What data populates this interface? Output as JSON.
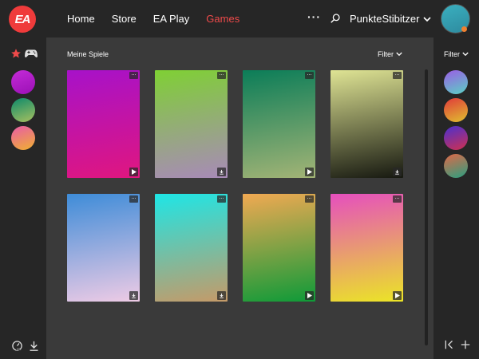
{
  "brand": {
    "logo_text": "EA",
    "accent": "#ef3b3b"
  },
  "nav": {
    "items": [
      {
        "label": "Home",
        "active": false
      },
      {
        "label": "Store",
        "active": false
      },
      {
        "label": "EA Play",
        "active": false
      },
      {
        "label": "Games",
        "active": true
      }
    ],
    "more_label": "···",
    "search_icon": "search-icon",
    "username": "PunkteStibitzer"
  },
  "left_rail": {
    "icons": [
      "star-icon",
      "gamepad-icon"
    ],
    "avatars": [
      {
        "name": "rail-avatar-1",
        "gradient": [
          "#c42bd8",
          "#9b10b5"
        ]
      },
      {
        "name": "rail-avatar-2",
        "gradient": [
          "#0c8a6a",
          "#a8c060"
        ]
      },
      {
        "name": "rail-avatar-3",
        "gradient": [
          "#e85ca8",
          "#f0b030"
        ]
      }
    ],
    "bottom_icons": [
      "speed-test-icon",
      "download-icon"
    ]
  },
  "main": {
    "title": "Meine Spiele",
    "filter_label": "Filter",
    "cards": [
      {
        "name": "game-card-1",
        "gradient": [
          "#a712c9",
          "#e0167f"
        ],
        "action": "play"
      },
      {
        "name": "game-card-2",
        "gradient": [
          "#7fd034",
          "#a88ab8"
        ],
        "action": "download"
      },
      {
        "name": "game-card-3",
        "gradient": [
          "#0b7d58",
          "#a3b476"
        ],
        "action": "play"
      },
      {
        "name": "game-card-4",
        "gradient": [
          "#dfe494",
          "#161810"
        ],
        "action": "download"
      },
      {
        "name": "game-card-5",
        "gradient": [
          "#3e8cd8",
          "#eecbe5"
        ],
        "action": "download"
      },
      {
        "name": "game-card-6",
        "gradient": [
          "#1ee6e6",
          "#c59a68"
        ],
        "action": "download"
      },
      {
        "name": "game-card-7",
        "gradient": [
          "#f1a952",
          "#0e9a38"
        ],
        "action": "play"
      },
      {
        "name": "game-card-8",
        "gradient": [
          "#e64fbe",
          "#ebe526"
        ],
        "action": "play"
      }
    ]
  },
  "right_rail": {
    "filter_label": "Filter",
    "avatars": [
      {
        "name": "right-avatar-1",
        "gradient": [
          "#9b5de5",
          "#5ad1c4"
        ]
      },
      {
        "name": "right-avatar-2",
        "gradient": [
          "#e03a3a",
          "#e0c030"
        ]
      },
      {
        "name": "right-avatar-3",
        "gradient": [
          "#4a30d0",
          "#d03050"
        ]
      },
      {
        "name": "right-avatar-4",
        "gradient": [
          "#e06848",
          "#2aa080"
        ]
      }
    ],
    "bottom_icons": [
      "collapse-left-icon",
      "add-icon"
    ]
  }
}
